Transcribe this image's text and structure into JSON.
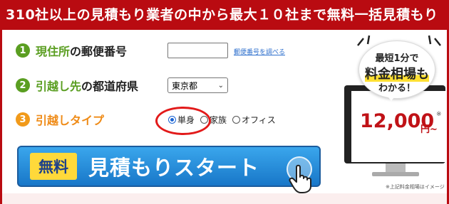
{
  "header": {
    "title": "310社以上の見積もり業者の中から最大１０社まで無料一括見積もり"
  },
  "steps": [
    {
      "number": "1",
      "label_accent": "現住所",
      "label_rest": "の郵便番号"
    },
    {
      "number": "2",
      "label_accent": "引越し先",
      "label_rest": "の都道府県"
    },
    {
      "number": "3",
      "label_accent": "引越しタイプ",
      "label_rest": ""
    }
  ],
  "postal": {
    "value": "",
    "lookup_link": "郵便番号を調べる"
  },
  "prefecture": {
    "selected": "東京都"
  },
  "move_type": {
    "options": [
      "単身",
      "家族",
      "オフィス"
    ],
    "selected": "単身"
  },
  "start_button": {
    "badge": "無料",
    "label": "見積もりスタート"
  },
  "promo": {
    "line1": "最短1分で",
    "line2": "料金相場",
    "line2_suffix": "も",
    "line3": "わかる！",
    "price": "12,000",
    "unit": "円~",
    "asterisk": "※",
    "note": "※上記料金相場はイメージ"
  },
  "colors": {
    "brand_red": "#b90b11",
    "step_green": "#5a9e21",
    "step_orange": "#f19a1a",
    "button_blue": "#1877c8",
    "badge_yellow": "#ffd93a"
  }
}
